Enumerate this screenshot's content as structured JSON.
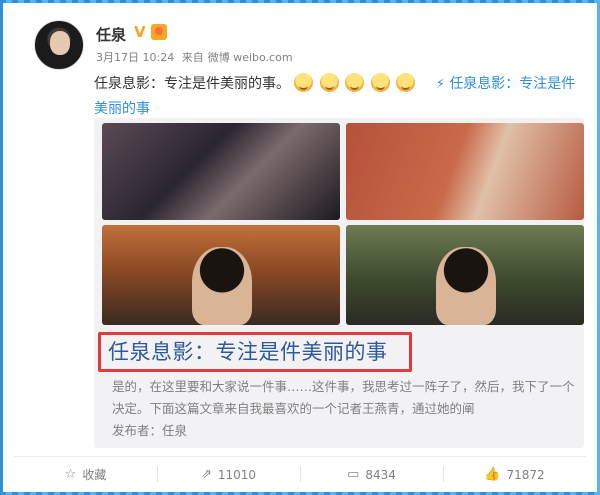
{
  "post": {
    "username": "任泉",
    "date": "3月17日 10:24",
    "source_prefix": "来自",
    "source": "微博 weibo.com",
    "text": "任泉息影：专注是件美丽的事。",
    "emoji_count": 5,
    "link_text": "任泉息影：专注是件美丽的事",
    "link_icon": "link-icon"
  },
  "article": {
    "title": "任泉息影：专注是件美丽的事",
    "summary": "是的，在这里要和大家说一件事……这件事，我思考过一阵子了，然后，我下了一个决定。下面这篇文章来自我最喜欢的一个记者王燕青，通过她的阐",
    "publisher": "发布者：任泉"
  },
  "actions": {
    "favorite": {
      "label": "收藏",
      "icon": "star-icon"
    },
    "repost": {
      "label": "11010",
      "icon": "repost-icon"
    },
    "comment": {
      "label": "8434",
      "icon": "comment-icon"
    },
    "like": {
      "label": "71872",
      "icon": "thumbs-up-icon"
    }
  },
  "colors": {
    "accent": "#2f8fd8",
    "highlight_box": "#e03a3a",
    "verified": "#f5a623"
  }
}
